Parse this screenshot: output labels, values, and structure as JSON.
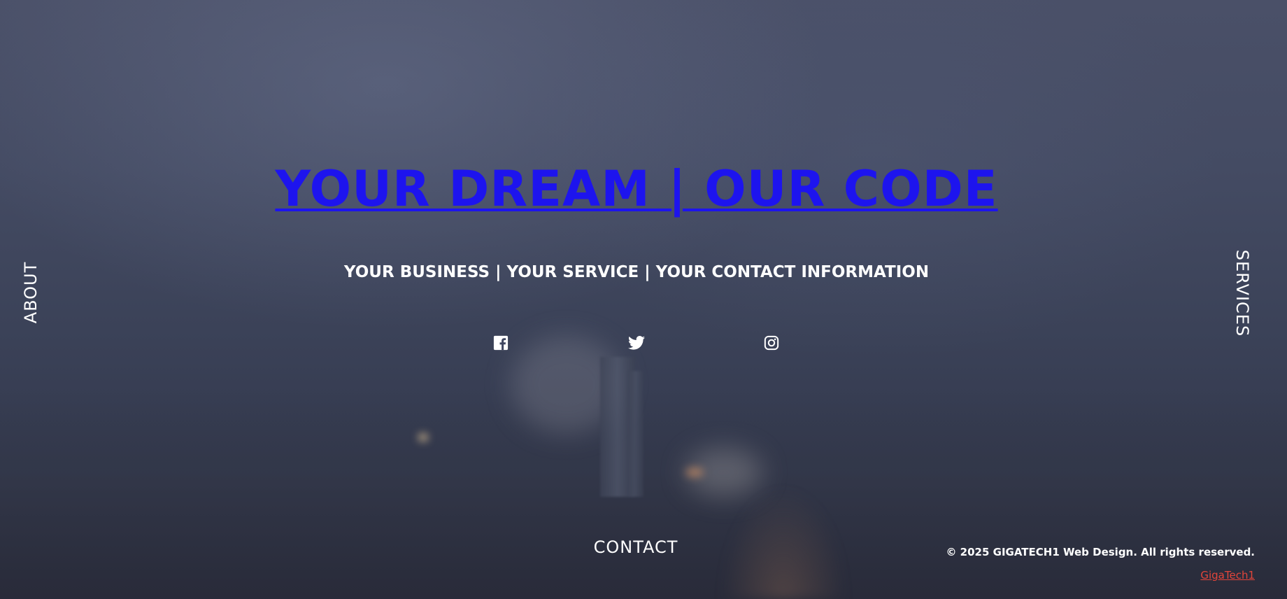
{
  "hero": {
    "title": "YOUR DREAM | OUR CODE",
    "subtitle": "YOUR BUSINESS | YOUR SERVICE | YOUR CONTACT INFORMATION"
  },
  "nav": {
    "about": "ABOUT",
    "services": "SERVICES",
    "contact": "CONTACT"
  },
  "social": [
    {
      "icon": "facebook-icon"
    },
    {
      "icon": "twitter-icon"
    },
    {
      "icon": "instagram-icon"
    }
  ],
  "footer": {
    "copyright": "© 2025 GIGATECH1 Web Design. All rights reserved.",
    "credit": "GigaTech1"
  },
  "colors": {
    "title_link": "#1d14ee",
    "credit_link": "#e2453a",
    "text": "#ffffff",
    "background": "#3b4258"
  }
}
